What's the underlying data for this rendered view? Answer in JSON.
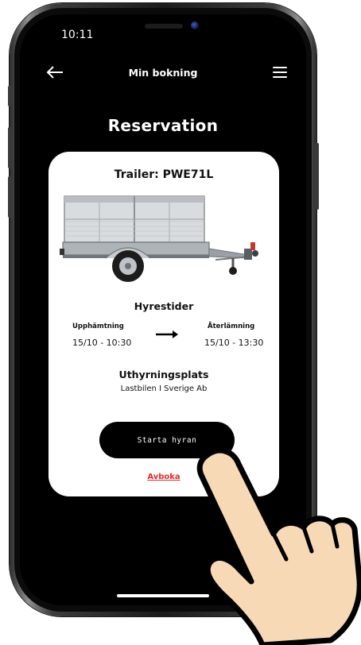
{
  "status_bar": {
    "time": "10:11"
  },
  "nav": {
    "back_icon": "arrow-left-icon",
    "title": "Min bokning",
    "menu_icon": "hamburger-menu-icon"
  },
  "page": {
    "title": "Reservation"
  },
  "booking": {
    "trailer_title": "Trailer: PWE71L",
    "rental_times_heading": "Hyrestider",
    "pickup_label": "Upphämtning",
    "pickup_time": "15/10 - 10:30",
    "return_label": "Återlämning",
    "return_time": "15/10 - 13:30",
    "location_heading": "Uthyrningsplats",
    "location_value": "Lastbilen I Sverige Ab"
  },
  "actions": {
    "start_label": "Starta hyran",
    "cancel_label": "Avboka"
  },
  "colors": {
    "screen_bg": "#000000",
    "card_bg": "#ffffff",
    "primary_button": "#000000",
    "cancel_link": "#e02b2b",
    "hand_skin": "#f7d9b5"
  }
}
